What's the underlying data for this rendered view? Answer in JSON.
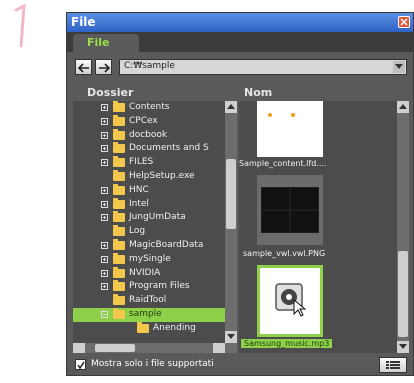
{
  "step": {
    "number_icon": "numeral-one-icon"
  },
  "window": {
    "title": "File",
    "tab": "File",
    "path": "C:₩sample",
    "folder_header": "Dossier",
    "name_header": "Nom",
    "tree": [
      {
        "label": "Contents",
        "expand": "plus"
      },
      {
        "label": "CPCex",
        "expand": "plus"
      },
      {
        "label": "docbook",
        "expand": "plus"
      },
      {
        "label": "Documents and S",
        "expand": "plus"
      },
      {
        "label": "FILES",
        "expand": "plus"
      },
      {
        "label": "HelpSetup.exe",
        "expand": "none"
      },
      {
        "label": "HNC",
        "expand": "plus"
      },
      {
        "label": "Intel",
        "expand": "plus"
      },
      {
        "label": "JungUmData",
        "expand": "plus"
      },
      {
        "label": "Log",
        "expand": "none"
      },
      {
        "label": "MagicBoardData",
        "expand": "plus"
      },
      {
        "label": "mySingle",
        "expand": "plus"
      },
      {
        "label": "NVIDIA",
        "expand": "plus"
      },
      {
        "label": "Program Files",
        "expand": "plus"
      },
      {
        "label": "RaidTool",
        "expand": "none"
      },
      {
        "label": "sample",
        "expand": "minus",
        "selected": true
      },
      {
        "label": "Anending",
        "expand": "none",
        "child": true
      }
    ],
    "files": [
      {
        "caption": "Sample_content.lfd....",
        "icon": "content-thumbnail-icon"
      },
      {
        "caption": "sample_vwl.vwl.PNG",
        "icon": "image-thumbnail-icon"
      },
      {
        "caption": "Samsung_music.mp3",
        "icon": "music-file-icon",
        "selected": true
      }
    ],
    "checkbox_label": "Mostra solo i file supportati",
    "checkbox_checked": true
  },
  "colors": {
    "accent_green": "#8fd04a",
    "tab_green": "#9be04a",
    "title_blue": "#2f62c8"
  }
}
